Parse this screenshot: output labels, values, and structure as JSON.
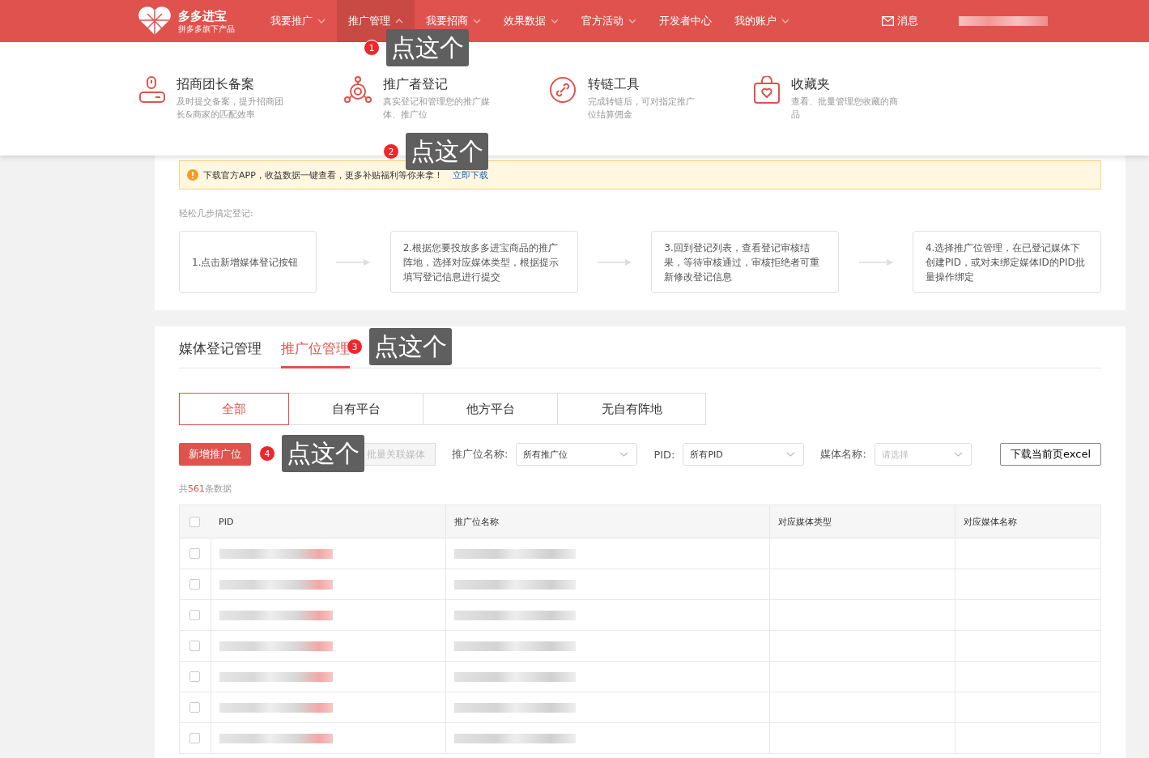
{
  "header": {
    "brand": "多多进宝",
    "tagline": "拼多多旗下产品",
    "nav": [
      {
        "label": "我要推广",
        "has_menu": true,
        "selected": false
      },
      {
        "label": "推广管理",
        "has_menu": true,
        "selected": true,
        "callout": {
          "number": "1",
          "label": "点这个"
        }
      },
      {
        "label": "我要招商",
        "has_menu": true,
        "selected": false
      },
      {
        "label": "效果数据",
        "has_menu": true,
        "selected": false
      },
      {
        "label": "官方活动",
        "has_menu": true,
        "selected": false
      },
      {
        "label": "开发者中心",
        "has_menu": false,
        "selected": false
      },
      {
        "label": "我的账户",
        "has_menu": true,
        "selected": false
      }
    ],
    "messages": "消息"
  },
  "dropdown": [
    {
      "title": "招商团长备案",
      "desc": "及时提交备案，提升招商团长&商家的匹配效率"
    },
    {
      "title": "推广者登记",
      "desc": "真实登记和管理您的推广媒体、推广位",
      "callout": {
        "number": "2",
        "label": "点这个"
      }
    },
    {
      "title": "转链工具",
      "desc": "完成转链后，可对指定推广位结算佣金"
    },
    {
      "title": "收藏夹",
      "desc": "查看、批量管理您收藏的商品"
    }
  ],
  "notice": {
    "text": "下载官方APP，收益数据一键查看，更多补贴福利等你来拿！",
    "link": "立即下载"
  },
  "steps_title": "轻松几步搞定登记:",
  "steps": [
    "1.点击新增媒体登记按钮",
    "2.根据您要投放多多进宝商品的推广阵地，选择对应媒体类型，根据提示填写登记信息进行提交",
    "3.回到登记列表，查看登记审核结果，等待审核通过，审核拒绝者可重新修改登记信息",
    "4.选择推广位管理，在已登记媒体下创建PID，或对未绑定媒体ID的PID批量操作绑定"
  ],
  "tabs": [
    {
      "label": "媒体登记管理",
      "selected": false
    },
    {
      "label": "推广位管理",
      "selected": true,
      "callout": {
        "number": "3",
        "label": "点这个"
      }
    }
  ],
  "segments": [
    {
      "label": "全部",
      "selected": true
    },
    {
      "label": "自有平台",
      "selected": false
    },
    {
      "label": "他方平台",
      "selected": false
    },
    {
      "label": "无自有阵地",
      "selected": false
    }
  ],
  "toolbar": {
    "add_button": "新增推广位",
    "add_callout": {
      "number": "4",
      "label": "点这个"
    },
    "bulk_button": "批量关联媒体",
    "bulk_disabled": true,
    "filters": [
      {
        "label": "推广位名称:",
        "value": "所有推广位"
      },
      {
        "label": "PID:",
        "value": "所有PID"
      },
      {
        "label": "媒体名称:",
        "placeholder": "请选择"
      }
    ],
    "export_button": "下载当前页excel"
  },
  "count": {
    "prefix": "共",
    "number": "561",
    "suffix": "条数据"
  },
  "table": {
    "all_checked": false,
    "columns": [
      "PID",
      "推广位名称",
      "对应媒体类型",
      "对应媒体名称"
    ],
    "rows": [
      {
        "checked": false
      },
      {
        "checked": false
      },
      {
        "checked": false
      },
      {
        "checked": false
      },
      {
        "checked": false
      },
      {
        "checked": false
      },
      {
        "checked": false
      }
    ]
  }
}
